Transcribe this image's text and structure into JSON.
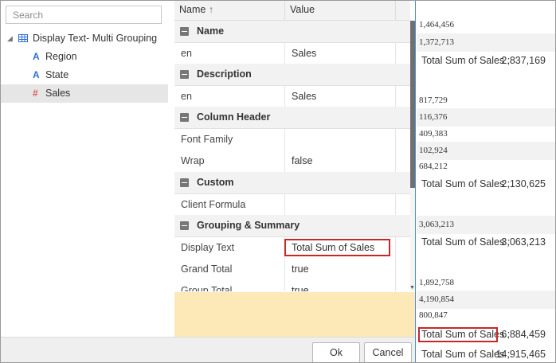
{
  "tree": {
    "search_placeholder": "Search",
    "root": {
      "label": "Display Text- Multi Grouping",
      "icon": "table-grid-icon"
    },
    "items": [
      {
        "label": "Region",
        "icon": "text-field-icon"
      },
      {
        "label": "State",
        "icon": "text-field-icon"
      },
      {
        "label": "Sales",
        "icon": "numeric-field-icon",
        "selected": true
      }
    ]
  },
  "properties": {
    "header": {
      "name": "Name",
      "sort_icon": "sort-ascending-icon",
      "value": "Value"
    },
    "sections": [
      {
        "title": "Name",
        "rows": [
          {
            "key": "en",
            "value": "Sales"
          }
        ]
      },
      {
        "title": "Description",
        "rows": [
          {
            "key": "en",
            "value": "Sales"
          }
        ]
      },
      {
        "title": "Column Header",
        "rows": [
          {
            "key": "Font Family",
            "value": ""
          },
          {
            "key": "Wrap",
            "value": "false"
          }
        ]
      },
      {
        "title": "Custom",
        "rows": [
          {
            "key": "Client Formula",
            "value": ""
          }
        ]
      },
      {
        "title": "Grouping & Summary",
        "rows": [
          {
            "key": "Display Text",
            "value": "Total Sum of Sales",
            "highlighted": true
          },
          {
            "key": "Grand Total",
            "value": "true"
          },
          {
            "key": "Group Total",
            "value": "true"
          }
        ]
      }
    ]
  },
  "preview": {
    "groups": [
      {
        "values": [
          "1,464,456",
          "1,372,713"
        ],
        "total_label": "Total Sum of Sales :",
        "total_value": "2,837,169"
      },
      {
        "values": [
          "817,729",
          "116,376",
          "409,383",
          "102,924",
          "684,212"
        ],
        "total_label": "Total Sum of Sales :",
        "total_value": "2,130,625"
      },
      {
        "values": [
          "3,063,213"
        ],
        "total_label": "Total Sum of Sales :",
        "total_value": "3,063,213"
      },
      {
        "values": [
          "1,892,758",
          "4,190,854",
          "800,847"
        ],
        "total_label": "Total Sum of Sales :",
        "total_value": "6,884,459",
        "label_highlighted": true
      }
    ],
    "grand_total": {
      "label": "Total Sum of Sales :",
      "value": "14,915,465"
    }
  },
  "footer": {
    "ok_label": "Ok",
    "cancel_label": "Cancel"
  },
  "colors": {
    "highlight": "#c62828",
    "accent_blue": "#2f6fd1",
    "numeric_icon": "#e05555",
    "footer_yellow": "#fde9b8"
  }
}
